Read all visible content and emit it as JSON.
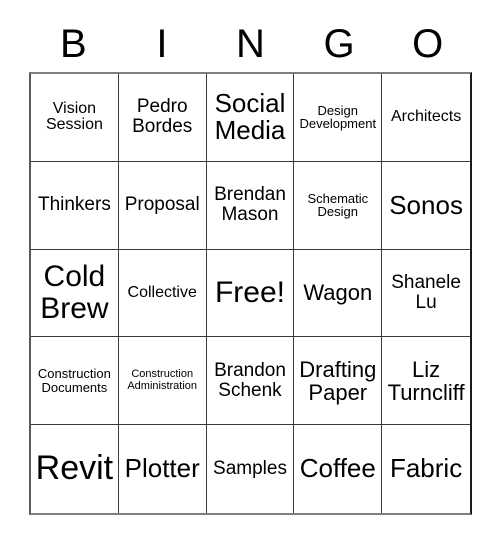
{
  "header": {
    "letters": [
      "B",
      "I",
      "N",
      "G",
      "O"
    ]
  },
  "grid": {
    "rows": 5,
    "columns": 5,
    "cells": [
      {
        "text": "Vision\nSession",
        "size": "md"
      },
      {
        "text": "Pedro\nBordes",
        "size": "lg"
      },
      {
        "text": "Social\nMedia",
        "size": "2xl"
      },
      {
        "text": "Design\nDevelopment",
        "size": "sm"
      },
      {
        "text": "Architects",
        "size": "md"
      },
      {
        "text": "Thinkers",
        "size": "lg"
      },
      {
        "text": "Proposal",
        "size": "lg"
      },
      {
        "text": "Brendan\nMason",
        "size": "lg"
      },
      {
        "text": "Schematic\nDesign",
        "size": "sm"
      },
      {
        "text": "Sonos",
        "size": "2xl"
      },
      {
        "text": "Cold\nBrew",
        "size": "3xl"
      },
      {
        "text": "Collective",
        "size": "md"
      },
      {
        "text": "Free!",
        "size": "3xl"
      },
      {
        "text": "Wagon",
        "size": "xl"
      },
      {
        "text": "Shanele\nLu",
        "size": "lg"
      },
      {
        "text": "Construction\nDocuments",
        "size": "sm"
      },
      {
        "text": "Construction\nAdministration",
        "size": "xs"
      },
      {
        "text": "Brandon\nSchenk",
        "size": "lg"
      },
      {
        "text": "Drafting\nPaper",
        "size": "xl"
      },
      {
        "text": "Liz\nTurncliff",
        "size": "xl"
      },
      {
        "text": "Revit",
        "size": "4xl"
      },
      {
        "text": "Plotter",
        "size": "2xl"
      },
      {
        "text": "Samples",
        "size": "lg"
      },
      {
        "text": "Coffee",
        "size": "2xl"
      },
      {
        "text": "Fabric",
        "size": "2xl"
      }
    ]
  },
  "colors": {
    "background": "#ffffff",
    "text": "#000000",
    "grid_line": "#3a3a3a",
    "outer_border": "#1a1a1a"
  }
}
